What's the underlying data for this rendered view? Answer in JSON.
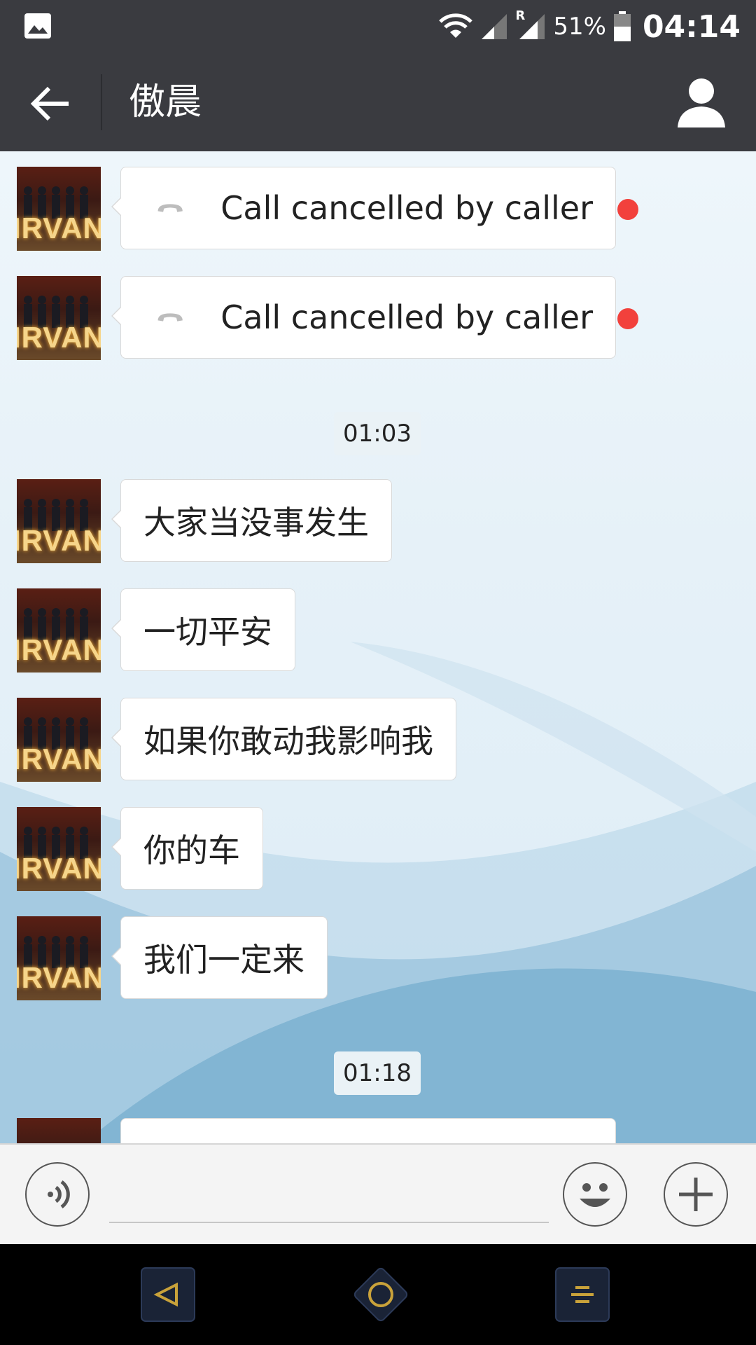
{
  "status_bar": {
    "battery_percent": "51%",
    "time": "04:14",
    "network_roaming": "R"
  },
  "header": {
    "title": "傲晨"
  },
  "avatar_text": "IRVANA",
  "messages": [
    {
      "type": "call",
      "text": "Call cancelled by caller",
      "unread": true
    },
    {
      "type": "call",
      "text": "Call cancelled by caller",
      "unread": true
    },
    {
      "type": "time",
      "text": "01:03"
    },
    {
      "type": "text",
      "text": "大家当没事发生"
    },
    {
      "type": "text",
      "text": "一切平安"
    },
    {
      "type": "text",
      "text": "如果你敢动我影响我"
    },
    {
      "type": "text",
      "text": "你的车"
    },
    {
      "type": "text",
      "text": "我们一定来"
    },
    {
      "type": "time",
      "text": "01:18"
    }
  ],
  "input_bar": {
    "message_value": ""
  },
  "icons": {
    "gallery": "gallery-icon",
    "wifi": "wifi-icon",
    "signal": "signal-icon",
    "battery": "battery-icon",
    "back": "arrow-left-icon",
    "profile": "person-icon",
    "call": "phone-hangup-icon",
    "voice": "voice-icon",
    "emoji": "smiley-icon",
    "more": "plus-icon",
    "nav_back": "triangle-back-icon",
    "nav_home": "circle-home-icon",
    "nav_menu": "menu-icon"
  },
  "colors": {
    "header": "#3a3b40",
    "unread_dot": "#f2413c",
    "nav_accent": "#c9a23a"
  }
}
